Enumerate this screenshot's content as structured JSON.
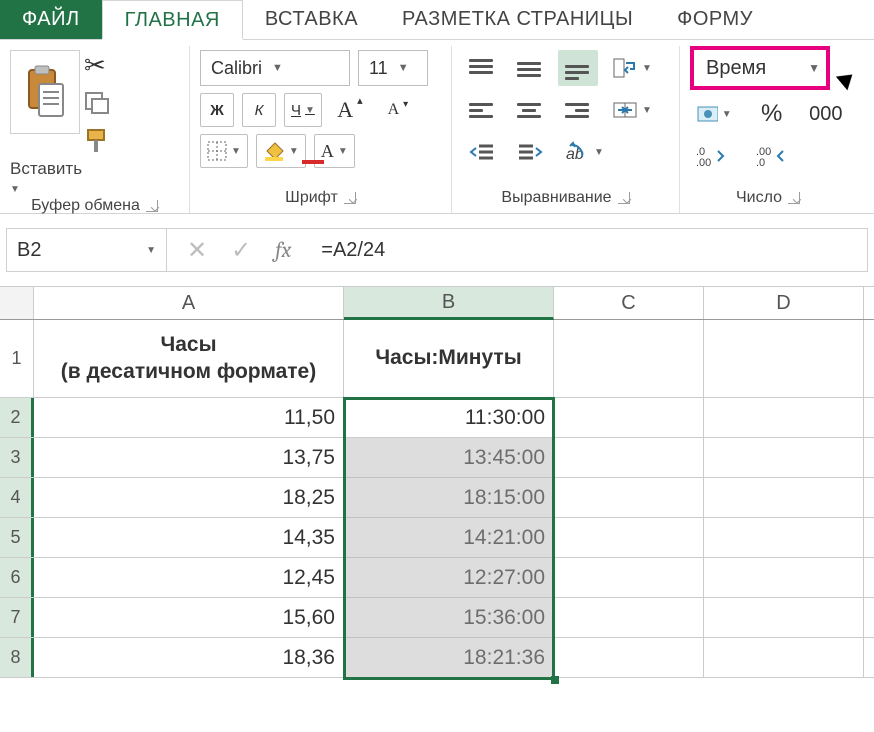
{
  "tabs": {
    "file": "ФАЙЛ",
    "home": "ГЛАВНАЯ",
    "insert": "ВСТАВКА",
    "layout": "РАЗМЕТКА СТРАНИЦЫ",
    "formulas": "ФОРМУ"
  },
  "ribbon": {
    "paste_label": "Вставить",
    "clipboard_group": "Буфер обмена",
    "font_name": "Calibri",
    "font_size": "11",
    "font_group": "Шрифт",
    "align_group": "Выравнивание",
    "number_group": "Число",
    "number_format": "Время",
    "bold": "Ж",
    "italic": "К",
    "underline": "Ч"
  },
  "formula_bar": {
    "cell_ref": "B2",
    "formula": "=A2/24"
  },
  "columns": {
    "A": "A",
    "B": "B",
    "C": "C",
    "D": "D"
  },
  "headers": {
    "A_line1": "Часы",
    "A_line2": "(в десатичном формате)",
    "B": "Часы:Минуты"
  },
  "rows": [
    {
      "n": "1"
    },
    {
      "n": "2",
      "A": "11,50",
      "B": "11:30:00"
    },
    {
      "n": "3",
      "A": "13,75",
      "B": "13:45:00"
    },
    {
      "n": "4",
      "A": "18,25",
      "B": "18:15:00"
    },
    {
      "n": "5",
      "A": "14,35",
      "B": "14:21:00"
    },
    {
      "n": "6",
      "A": "12,45",
      "B": "12:27:00"
    },
    {
      "n": "7",
      "A": "15,60",
      "B": "15:36:00"
    },
    {
      "n": "8",
      "A": "18,36",
      "B": "18:21:36"
    }
  ]
}
